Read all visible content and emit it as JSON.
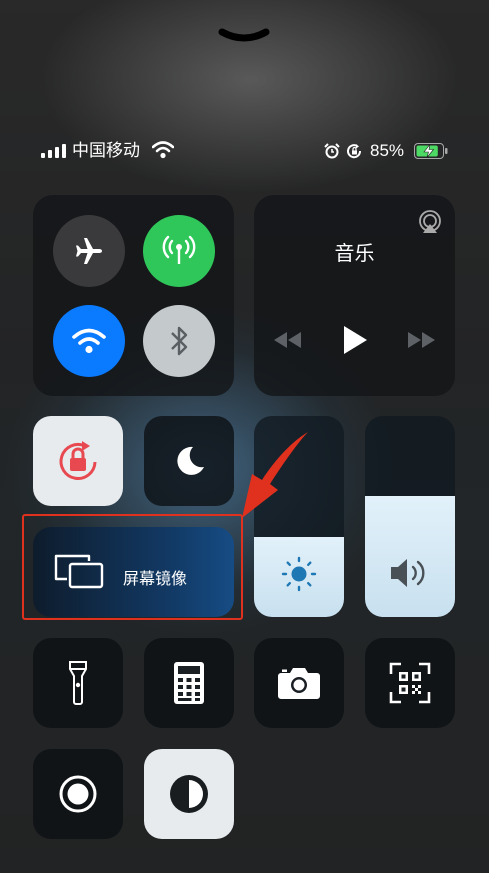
{
  "status_bar": {
    "carrier": "中国移动",
    "battery_percent": "85%",
    "battery_level": 0.85,
    "icons": [
      "signal-icon",
      "wifi-icon",
      "alarm-icon",
      "orientation-lock-icon",
      "battery-charging-icon"
    ]
  },
  "connectivity": {
    "airplane_mode": false,
    "cellular_data": true,
    "wifi": true,
    "bluetooth": false
  },
  "music": {
    "title": "音乐",
    "icons": [
      "airplay-icon",
      "previous-icon",
      "play-icon",
      "next-icon"
    ]
  },
  "screen_mirroring": {
    "label": "屏幕镜像"
  },
  "brightness": {
    "level": 0.4
  },
  "volume": {
    "level": 0.6
  },
  "colors": {
    "green": "#30c75a",
    "blue": "#0a7aff",
    "annotation_red": "#e0301e",
    "battery_green": "#4cd964"
  },
  "tiles": [
    "flashlight-icon",
    "calculator-icon",
    "camera-icon",
    "qr-scanner-icon",
    "screen-record-icon",
    "dark-mode-icon"
  ]
}
